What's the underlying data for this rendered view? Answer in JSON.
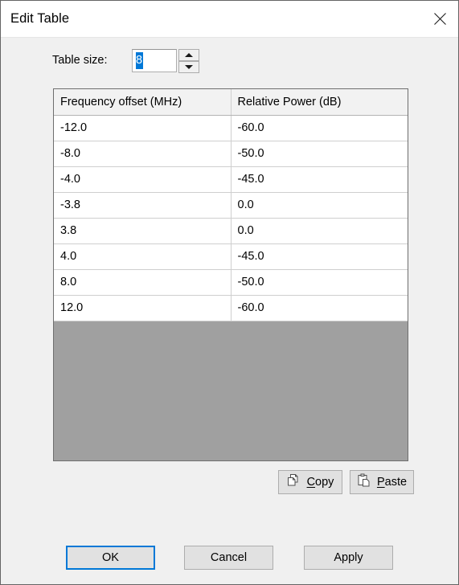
{
  "window": {
    "title": "Edit Table",
    "close_icon": "close-icon"
  },
  "table_size": {
    "label": "Table size:",
    "value": "8",
    "increment_icon": "triangle-up-icon",
    "decrement_icon": "triangle-down-icon"
  },
  "grid": {
    "columns": [
      "Frequency offset (MHz)",
      "Relative Power (dB)"
    ],
    "rows": [
      [
        "-12.0",
        "-60.0"
      ],
      [
        "-8.0",
        "-50.0"
      ],
      [
        "-4.0",
        "-45.0"
      ],
      [
        "-3.8",
        "0.0"
      ],
      [
        "3.8",
        "0.0"
      ],
      [
        "4.0",
        "-45.0"
      ],
      [
        "8.0",
        "-50.0"
      ],
      [
        "12.0",
        "-60.0"
      ]
    ]
  },
  "clipboard": {
    "copy": {
      "label": "Copy",
      "accel": "C",
      "icon": "copy-icon"
    },
    "paste": {
      "label": "Paste",
      "accel": "P",
      "icon": "paste-icon"
    }
  },
  "footer": {
    "ok": "OK",
    "cancel": "Cancel",
    "apply": "Apply"
  },
  "colors": {
    "accent": "#0078d7",
    "dialog_bg": "#f0f0f0",
    "button_face": "#e1e1e1",
    "empty_area": "#a0a0a0",
    "header_bg": "#f2f2f2"
  }
}
